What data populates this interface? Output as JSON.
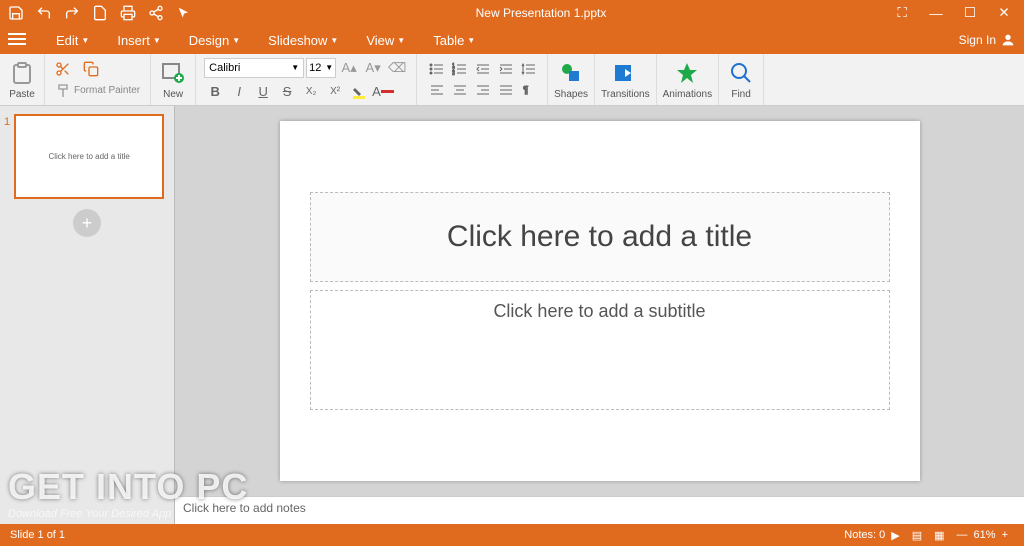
{
  "title": "New Presentation 1.pptx",
  "menus": {
    "edit": "Edit",
    "insert": "Insert",
    "design": "Design",
    "slideshow": "Slideshow",
    "view": "View",
    "table": "Table"
  },
  "signin": "Sign In",
  "ribbon": {
    "paste": "Paste",
    "formatPainter": "Format Painter",
    "new": "New",
    "font": "Calibri",
    "size": "12",
    "shapes": "Shapes",
    "transitions": "Transitions",
    "animations": "Animations",
    "find": "Find"
  },
  "thumb": {
    "num": "1",
    "title": "Click here to add a title"
  },
  "slide": {
    "title": "Click here to add a title",
    "subtitle": "Click here to add a subtitle"
  },
  "notes": "Click here to add notes",
  "status": {
    "slide": "Slide 1 of 1",
    "notes": "Notes: 0",
    "zoom": "61%"
  },
  "watermark": {
    "big": "GET INTO PC",
    "small": "Download Free Your Desired App"
  }
}
